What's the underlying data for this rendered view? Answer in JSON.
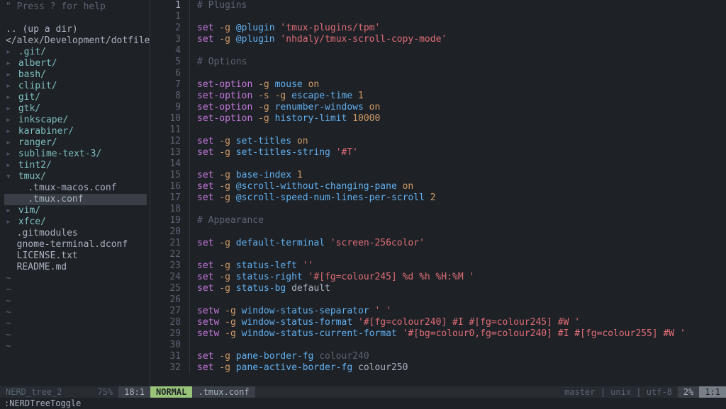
{
  "sidebar": {
    "help_hint": "\" Press ? for help",
    "up_dir": ".. (up a dir)",
    "cwd": "</alex/Development/dotfiles/",
    "selected_path": "tmux/.tmux.conf",
    "entries": [
      {
        "kind": "dir",
        "name": ".git/",
        "expanded": false,
        "depth": 0
      },
      {
        "kind": "dir",
        "name": "albert/",
        "expanded": false,
        "depth": 0
      },
      {
        "kind": "dir",
        "name": "bash/",
        "expanded": false,
        "depth": 0
      },
      {
        "kind": "dir",
        "name": "clipit/",
        "expanded": false,
        "depth": 0
      },
      {
        "kind": "dir",
        "name": "git/",
        "expanded": false,
        "depth": 0
      },
      {
        "kind": "dir",
        "name": "gtk/",
        "expanded": false,
        "depth": 0
      },
      {
        "kind": "dir",
        "name": "inkscape/",
        "expanded": false,
        "depth": 0
      },
      {
        "kind": "dir",
        "name": "karabiner/",
        "expanded": false,
        "depth": 0
      },
      {
        "kind": "dir",
        "name": "ranger/",
        "expanded": false,
        "depth": 0
      },
      {
        "kind": "dir",
        "name": "sublime-text-3/",
        "expanded": false,
        "depth": 0
      },
      {
        "kind": "dir",
        "name": "tint2/",
        "expanded": false,
        "depth": 0
      },
      {
        "kind": "dir",
        "name": "tmux/",
        "expanded": true,
        "depth": 0
      },
      {
        "kind": "file",
        "name": ".tmux-macos.conf",
        "depth": 1
      },
      {
        "kind": "file",
        "name": ".tmux.conf",
        "depth": 1
      },
      {
        "kind": "dir",
        "name": "vim/",
        "expanded": false,
        "depth": 0
      },
      {
        "kind": "dir",
        "name": "xfce/",
        "expanded": false,
        "depth": 0
      },
      {
        "kind": "file",
        "name": ".gitmodules",
        "depth": 0
      },
      {
        "kind": "file",
        "name": "gnome-terminal.dconf",
        "depth": 0
      },
      {
        "kind": "file",
        "name": "LICENSE.txt",
        "depth": 0
      },
      {
        "kind": "file",
        "name": "README.md",
        "depth": 0
      }
    ],
    "tilde_count": 7
  },
  "editor": {
    "filename": ".tmux.conf",
    "top_label": "# Plugins",
    "lines": [
      {
        "n": 1,
        "tokens": []
      },
      {
        "n": 2,
        "tokens": [
          {
            "t": "kw",
            "v": "set"
          },
          {
            "t": "sp"
          },
          {
            "t": "flag",
            "v": "-g"
          },
          {
            "t": "sp"
          },
          {
            "t": "opt",
            "v": "@plugin"
          },
          {
            "t": "sp"
          },
          {
            "t": "str",
            "v": "'tmux-plugins/tpm'"
          }
        ]
      },
      {
        "n": 3,
        "tokens": [
          {
            "t": "kw",
            "v": "set"
          },
          {
            "t": "sp"
          },
          {
            "t": "flag",
            "v": "-g"
          },
          {
            "t": "sp"
          },
          {
            "t": "opt",
            "v": "@plugin"
          },
          {
            "t": "sp"
          },
          {
            "t": "str",
            "v": "'nhdaly/tmux-scroll-copy-mode'"
          }
        ]
      },
      {
        "n": 4,
        "tokens": []
      },
      {
        "n": 5,
        "tokens": [
          {
            "t": "comment",
            "v": "# Options"
          }
        ]
      },
      {
        "n": 6,
        "tokens": []
      },
      {
        "n": 7,
        "tokens": [
          {
            "t": "kw",
            "v": "set-option"
          },
          {
            "t": "sp"
          },
          {
            "t": "flag",
            "v": "-g"
          },
          {
            "t": "sp"
          },
          {
            "t": "opt",
            "v": "mouse"
          },
          {
            "t": "sp"
          },
          {
            "t": "bool",
            "v": "on"
          }
        ]
      },
      {
        "n": 8,
        "tokens": [
          {
            "t": "kw",
            "v": "set-option"
          },
          {
            "t": "sp"
          },
          {
            "t": "flag",
            "v": "-s"
          },
          {
            "t": "sp"
          },
          {
            "t": "flag",
            "v": "-g"
          },
          {
            "t": "sp"
          },
          {
            "t": "opt",
            "v": "escape-time"
          },
          {
            "t": "sp"
          },
          {
            "t": "num",
            "v": "1"
          }
        ]
      },
      {
        "n": 9,
        "tokens": [
          {
            "t": "kw",
            "v": "set-option"
          },
          {
            "t": "sp"
          },
          {
            "t": "flag",
            "v": "-g"
          },
          {
            "t": "sp"
          },
          {
            "t": "opt",
            "v": "renumber-windows"
          },
          {
            "t": "sp"
          },
          {
            "t": "bool",
            "v": "on"
          }
        ]
      },
      {
        "n": 10,
        "tokens": [
          {
            "t": "kw",
            "v": "set-option"
          },
          {
            "t": "sp"
          },
          {
            "t": "flag",
            "v": "-g"
          },
          {
            "t": "sp"
          },
          {
            "t": "opt",
            "v": "history-limit"
          },
          {
            "t": "sp"
          },
          {
            "t": "num",
            "v": "10000"
          }
        ]
      },
      {
        "n": 11,
        "tokens": []
      },
      {
        "n": 12,
        "tokens": [
          {
            "t": "kw",
            "v": "set"
          },
          {
            "t": "sp"
          },
          {
            "t": "flag",
            "v": "-g"
          },
          {
            "t": "sp"
          },
          {
            "t": "opt",
            "v": "set-titles"
          },
          {
            "t": "sp"
          },
          {
            "t": "bool",
            "v": "on"
          }
        ]
      },
      {
        "n": 13,
        "tokens": [
          {
            "t": "kw",
            "v": "set"
          },
          {
            "t": "sp"
          },
          {
            "t": "flag",
            "v": "-g"
          },
          {
            "t": "sp"
          },
          {
            "t": "opt",
            "v": "set-titles-string"
          },
          {
            "t": "sp"
          },
          {
            "t": "str",
            "v": "'#T'"
          }
        ]
      },
      {
        "n": 14,
        "tokens": []
      },
      {
        "n": 15,
        "tokens": [
          {
            "t": "kw",
            "v": "set"
          },
          {
            "t": "sp"
          },
          {
            "t": "flag",
            "v": "-g"
          },
          {
            "t": "sp"
          },
          {
            "t": "opt",
            "v": "base-index"
          },
          {
            "t": "sp"
          },
          {
            "t": "num",
            "v": "1"
          }
        ]
      },
      {
        "n": 16,
        "tokens": [
          {
            "t": "kw",
            "v": "set"
          },
          {
            "t": "sp"
          },
          {
            "t": "flag",
            "v": "-g"
          },
          {
            "t": "sp"
          },
          {
            "t": "opt",
            "v": "@scroll-without-changing-pane"
          },
          {
            "t": "sp"
          },
          {
            "t": "bool",
            "v": "on"
          }
        ]
      },
      {
        "n": 17,
        "tokens": [
          {
            "t": "kw",
            "v": "set"
          },
          {
            "t": "sp"
          },
          {
            "t": "flag",
            "v": "-g"
          },
          {
            "t": "sp"
          },
          {
            "t": "opt",
            "v": "@scroll-speed-num-lines-per-scroll"
          },
          {
            "t": "sp"
          },
          {
            "t": "num",
            "v": "2"
          }
        ]
      },
      {
        "n": 18,
        "tokens": []
      },
      {
        "n": 19,
        "tokens": [
          {
            "t": "comment",
            "v": "# Appearance"
          }
        ]
      },
      {
        "n": 20,
        "tokens": []
      },
      {
        "n": 21,
        "tokens": [
          {
            "t": "kw",
            "v": "set"
          },
          {
            "t": "sp"
          },
          {
            "t": "flag",
            "v": "-g"
          },
          {
            "t": "sp"
          },
          {
            "t": "opt",
            "v": "default-terminal"
          },
          {
            "t": "sp"
          },
          {
            "t": "str",
            "v": "'screen-256color'"
          }
        ]
      },
      {
        "n": 22,
        "tokens": []
      },
      {
        "n": 23,
        "tokens": [
          {
            "t": "kw",
            "v": "set"
          },
          {
            "t": "sp"
          },
          {
            "t": "flag",
            "v": "-g"
          },
          {
            "t": "sp"
          },
          {
            "t": "opt",
            "v": "status-left"
          },
          {
            "t": "sp"
          },
          {
            "t": "str",
            "v": "''"
          }
        ]
      },
      {
        "n": 24,
        "tokens": [
          {
            "t": "kw",
            "v": "set"
          },
          {
            "t": "sp"
          },
          {
            "t": "flag",
            "v": "-g"
          },
          {
            "t": "sp"
          },
          {
            "t": "opt",
            "v": "status-right"
          },
          {
            "t": "sp"
          },
          {
            "t": "str",
            "v": "'#[fg=colour245] %d %h %H:%M '"
          }
        ]
      },
      {
        "n": 25,
        "tokens": [
          {
            "t": "kw",
            "v": "set"
          },
          {
            "t": "sp"
          },
          {
            "t": "flag",
            "v": "-g"
          },
          {
            "t": "sp"
          },
          {
            "t": "opt",
            "v": "status-bg"
          },
          {
            "t": "sp"
          },
          {
            "t": "plain",
            "v": "default"
          }
        ]
      },
      {
        "n": 26,
        "tokens": []
      },
      {
        "n": 27,
        "tokens": [
          {
            "t": "kw",
            "v": "setw"
          },
          {
            "t": "sp"
          },
          {
            "t": "flag",
            "v": "-g"
          },
          {
            "t": "sp"
          },
          {
            "t": "opt",
            "v": "window-status-separator"
          },
          {
            "t": "sp"
          },
          {
            "t": "str",
            "v": "' '"
          }
        ]
      },
      {
        "n": 28,
        "tokens": [
          {
            "t": "kw",
            "v": "setw"
          },
          {
            "t": "sp"
          },
          {
            "t": "flag",
            "v": "-g"
          },
          {
            "t": "sp"
          },
          {
            "t": "opt",
            "v": "window-status-format"
          },
          {
            "t": "sp"
          },
          {
            "t": "str",
            "v": "'#[fg=colour240] #I #[fg=colour245] #W '"
          }
        ]
      },
      {
        "n": 29,
        "tokens": [
          {
            "t": "kw",
            "v": "setw"
          },
          {
            "t": "sp"
          },
          {
            "t": "flag",
            "v": "-g"
          },
          {
            "t": "sp"
          },
          {
            "t": "opt",
            "v": "window-status-current-format"
          },
          {
            "t": "sp"
          },
          {
            "t": "str",
            "v": "'#[bg=colour0,fg=colour240] #I #[fg=colour255] #W '"
          }
        ]
      },
      {
        "n": 30,
        "tokens": []
      },
      {
        "n": 31,
        "tokens": [
          {
            "t": "kw",
            "v": "set"
          },
          {
            "t": "sp"
          },
          {
            "t": "flag",
            "v": "-g"
          },
          {
            "t": "sp"
          },
          {
            "t": "opt",
            "v": "pane-border-fg"
          },
          {
            "t": "sp"
          },
          {
            "t": "comment",
            "v": "colour240"
          }
        ]
      },
      {
        "n": 32,
        "tokens": [
          {
            "t": "kw",
            "v": "set"
          },
          {
            "t": "sp"
          },
          {
            "t": "flag",
            "v": "-g"
          },
          {
            "t": "sp"
          },
          {
            "t": "opt",
            "v": "pane-active-border-fg"
          },
          {
            "t": "sp"
          },
          {
            "t": "plain",
            "v": "colour250"
          }
        ]
      }
    ]
  },
  "status": {
    "left_pane": {
      "name": "NERD_tree_2",
      "percent": "75%",
      "pos": "18:1"
    },
    "right_pane": {
      "mode": "NORMAL",
      "filename": ".tmux.conf",
      "branch": "master",
      "fileinfo": "unix",
      "encoding": "utf-8",
      "percent": "2%",
      "pos": "1:1"
    }
  },
  "cmdline": ":NERDTreeToggle"
}
